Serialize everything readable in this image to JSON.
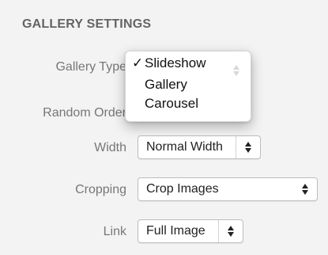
{
  "section": {
    "title": "GALLERY SETTINGS"
  },
  "fields": {
    "gallery_type": {
      "label": "Gallery Type",
      "options": [
        "Slideshow",
        "Gallery",
        "Carousel"
      ],
      "selected": "Slideshow"
    },
    "random_order": {
      "label": "Random Order"
    },
    "width": {
      "label": "Width",
      "value": "Normal Width"
    },
    "cropping": {
      "label": "Cropping",
      "value": "Crop Images"
    },
    "link": {
      "label": "Link",
      "value": "Full Image"
    }
  },
  "icons": {
    "checkmark": "✓"
  },
  "colors": {
    "panel_bg": "#f3f3f3",
    "label_text": "#777777",
    "title_text": "#646464"
  }
}
